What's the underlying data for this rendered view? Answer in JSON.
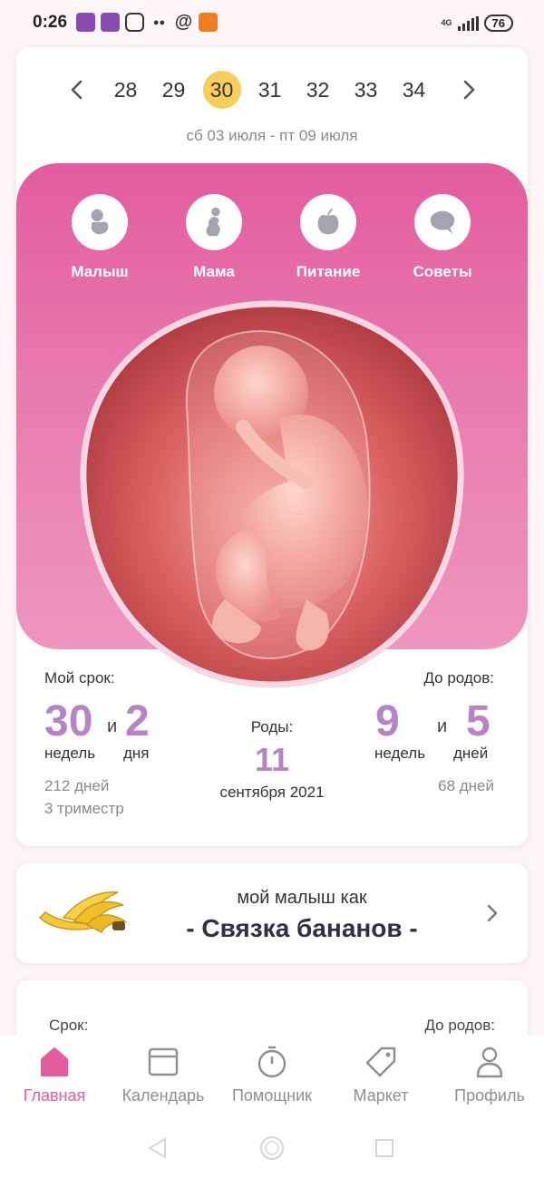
{
  "status_bar": {
    "time": "0:26",
    "network": "4G",
    "battery": "76",
    "icons": [
      "purple-app-icon",
      "purple-app-icon",
      "instagram-icon",
      "people-icon",
      "at-icon",
      "orange-app-icon"
    ]
  },
  "week_nav": {
    "weeks": [
      "28",
      "29",
      "30",
      "31",
      "32",
      "33",
      "34"
    ],
    "active_week": "30",
    "date_range": "сб 03 июля - пт 09 июля"
  },
  "categories": [
    {
      "label": "Малыш",
      "icon": "baby-icon"
    },
    {
      "label": "Мама",
      "icon": "mother-icon"
    },
    {
      "label": "Питание",
      "icon": "apple-icon"
    },
    {
      "label": "Советы",
      "icon": "chat-bubble-icon"
    }
  ],
  "my_term": {
    "label": "Мой срок:",
    "weeks": "30",
    "and": "и",
    "days": "2",
    "weeks_word": "недель",
    "days_word": "дня",
    "total_days": "212 дней",
    "trimester": "3 триместр"
  },
  "birth": {
    "label": "Роды:",
    "day": "11",
    "month_year": "сентября 2021"
  },
  "until_birth": {
    "label": "До родов:",
    "weeks": "9",
    "and": "и",
    "days": "5",
    "weeks_word": "недель",
    "days_word": "дней",
    "total_days": "68 дней"
  },
  "fruit_card": {
    "subtitle": "мой малыш как",
    "title": "- Связка бананов -"
  },
  "third_card": {
    "left_label": "Срок:",
    "right_label": "До родов:"
  },
  "bottom_nav": [
    {
      "label": "Главная",
      "icon": "home-icon",
      "active": true
    },
    {
      "label": "Календарь",
      "icon": "calendar-icon",
      "active": false
    },
    {
      "label": "Помощник",
      "icon": "stopwatch-icon",
      "active": false
    },
    {
      "label": "Маркет",
      "icon": "tag-icon",
      "active": false
    },
    {
      "label": "Профиль",
      "icon": "person-icon",
      "active": false
    }
  ],
  "colors": {
    "accent_pink": "#e35d9f",
    "numbers_purple": "#b583c6",
    "active_week": "#f7ce5b"
  }
}
